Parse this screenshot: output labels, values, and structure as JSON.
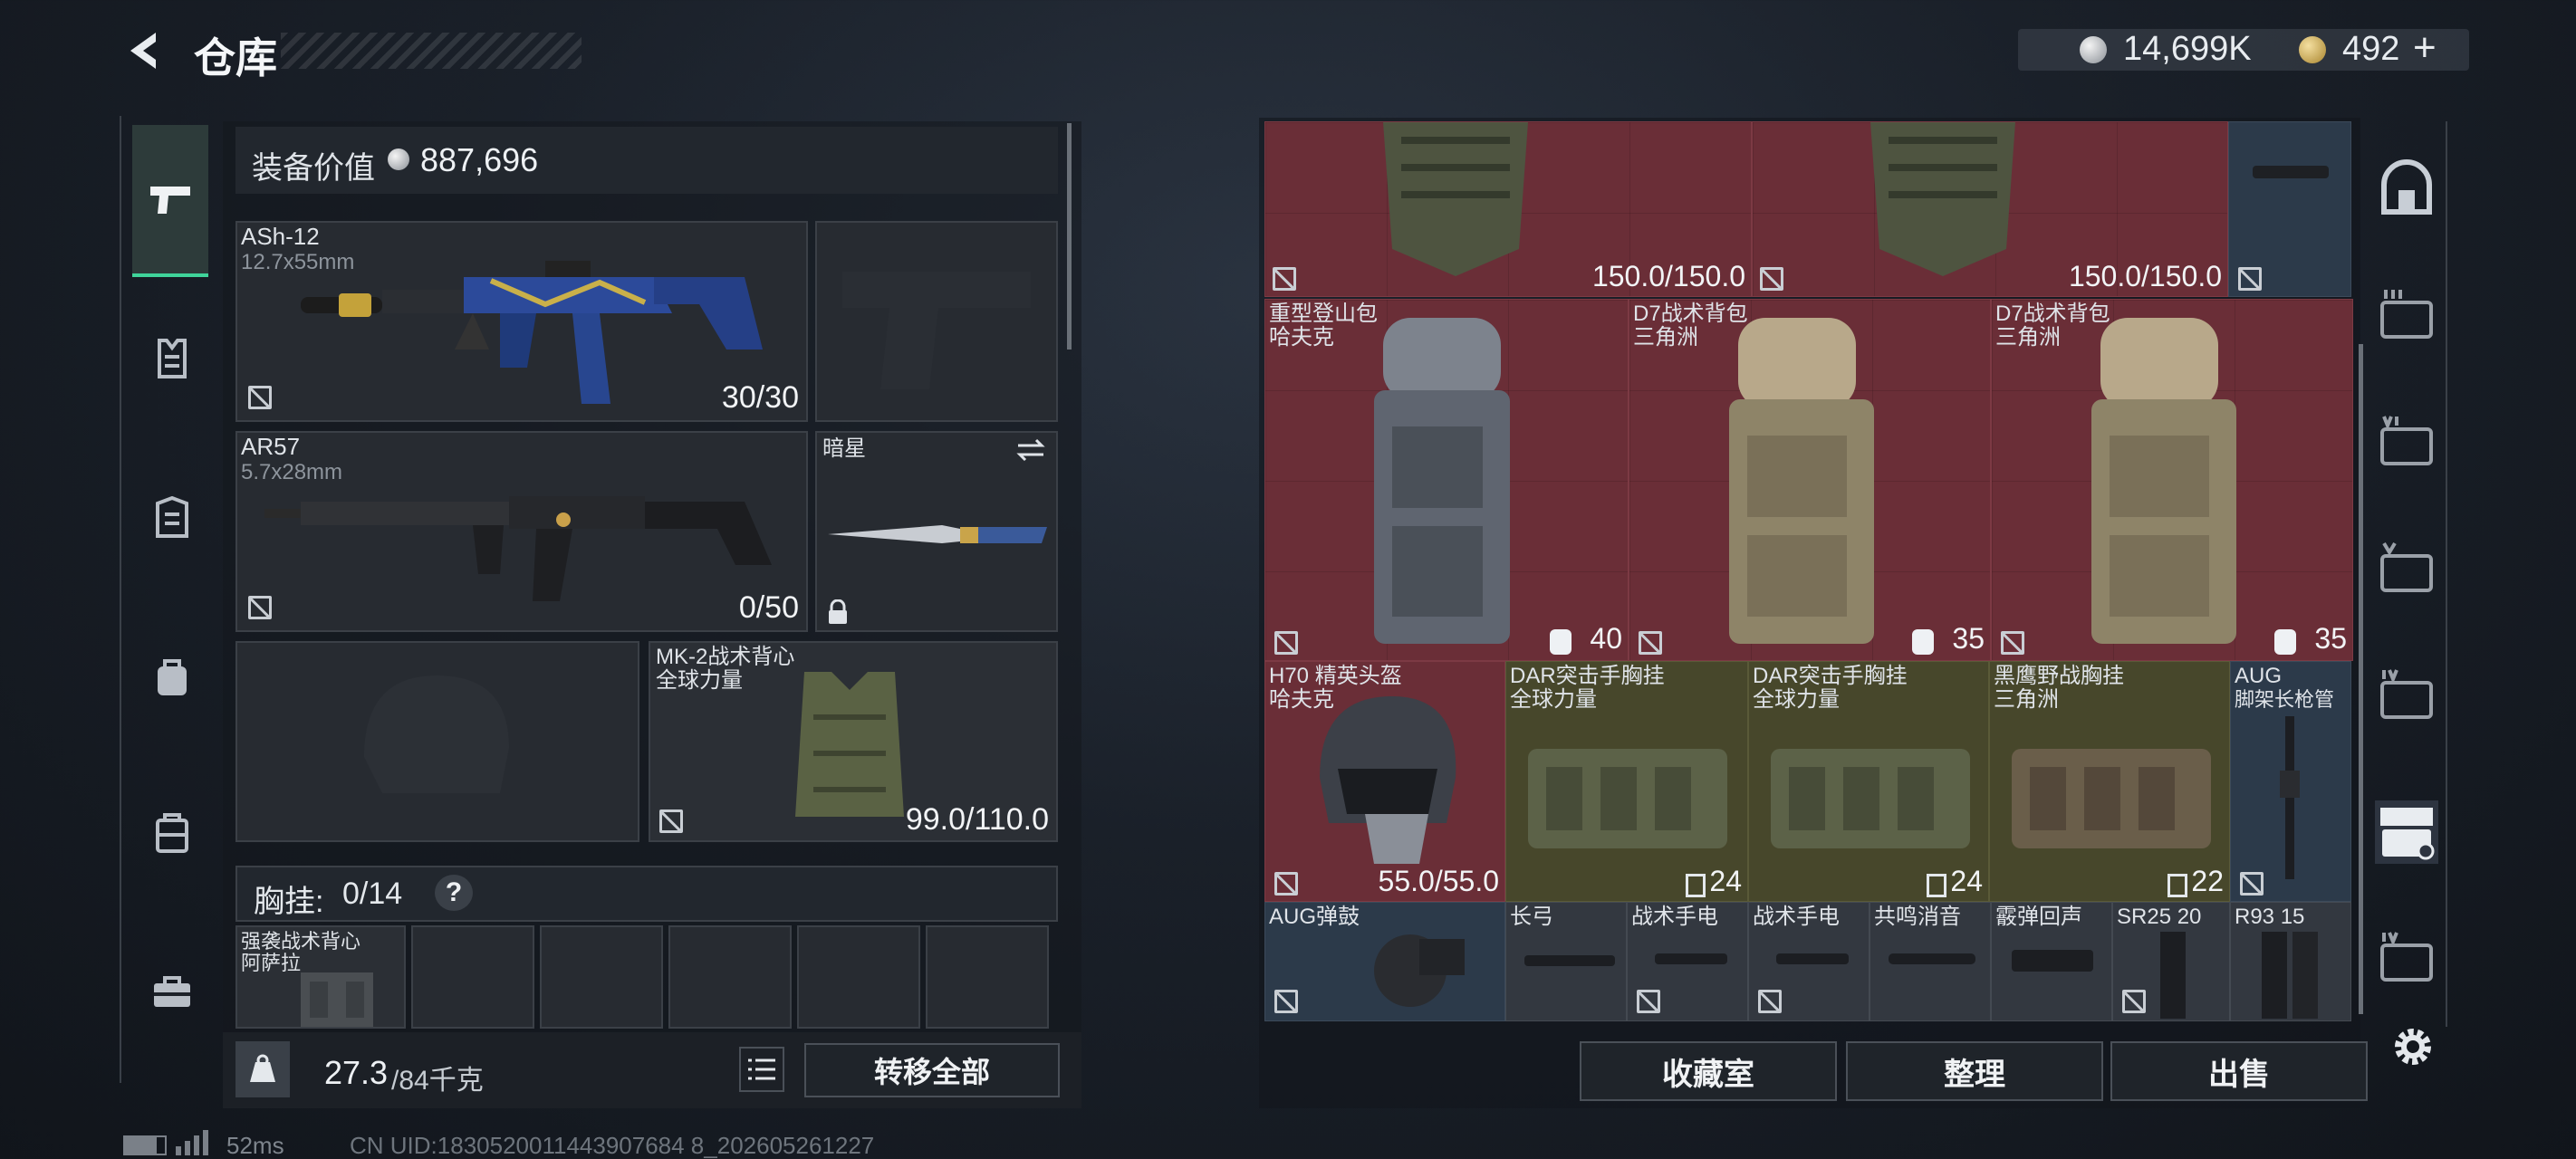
{
  "header": {
    "title": "仓库",
    "currency_coins": "14,699K",
    "currency_premium": "492",
    "premium_add": "+"
  },
  "equipment": {
    "value_label": "装备价值",
    "value": "887,696",
    "primary": {
      "name": "ASh-12",
      "caliber": "12.7x55mm",
      "ammo": "30/30"
    },
    "secondary": {
      "name": "AR57",
      "caliber": "5.7x28mm",
      "ammo": "0/50"
    },
    "melee": {
      "name": "暗星"
    },
    "armor": {
      "name": "MK-2战术背心",
      "maker": "全球力量",
      "durability": "99.0/110.0"
    },
    "rig_label": "胸挂:",
    "rig_capacity": "0/14",
    "rig_help": "?",
    "rig_item": {
      "name": "强袭战术背心",
      "maker": "阿萨拉"
    },
    "weight": "27.3",
    "weight_max": "/84千克",
    "transfer_all": "转移全部"
  },
  "stash": {
    "row1": [
      {
        "durability": "150.0/150.0"
      },
      {
        "durability": "150.0/150.0"
      }
    ],
    "backpacks": [
      {
        "name": "重型登山包",
        "maker": "哈夫克",
        "count": "40"
      },
      {
        "name": "D7战术背包",
        "maker": "三角洲",
        "count": "35"
      },
      {
        "name": "D7战术背包",
        "maker": "三角洲",
        "count": "35"
      }
    ],
    "row3": [
      {
        "name": "H70 精英头盔",
        "maker": "哈夫克",
        "value": "55.0/55.0"
      },
      {
        "name": "DAR突击手胸挂",
        "maker": "全球力量",
        "value": "24"
      },
      {
        "name": "DAR突击手胸挂",
        "maker": "全球力量",
        "value": "24"
      },
      {
        "name": "黑鹰野战胸挂",
        "maker": "三角洲",
        "value": "22"
      },
      {
        "name": "AUG",
        "maker": "脚架长枪管",
        "value": ""
      }
    ],
    "row4": [
      {
        "name": "AUG弹鼓"
      },
      {
        "name": "长弓"
      },
      {
        "name": "战术手电"
      },
      {
        "name": "战术手电"
      },
      {
        "name": "共鸣消音"
      },
      {
        "name": "霰弹回声"
      },
      {
        "name": "SR25 20"
      },
      {
        "name": "R93 15"
      }
    ]
  },
  "bottom_buttons": {
    "collection": "收藏室",
    "sort": "整理",
    "sell": "出售"
  },
  "status": {
    "ping": "52ms",
    "uid": "CN UID:1830520011443907684 8_202605261227"
  },
  "colors": {
    "slot_red": "#6a2e37",
    "slot_olive": "#47472b",
    "slot_blue": "#2c3a4a",
    "accent_green": "#3fd49a"
  }
}
